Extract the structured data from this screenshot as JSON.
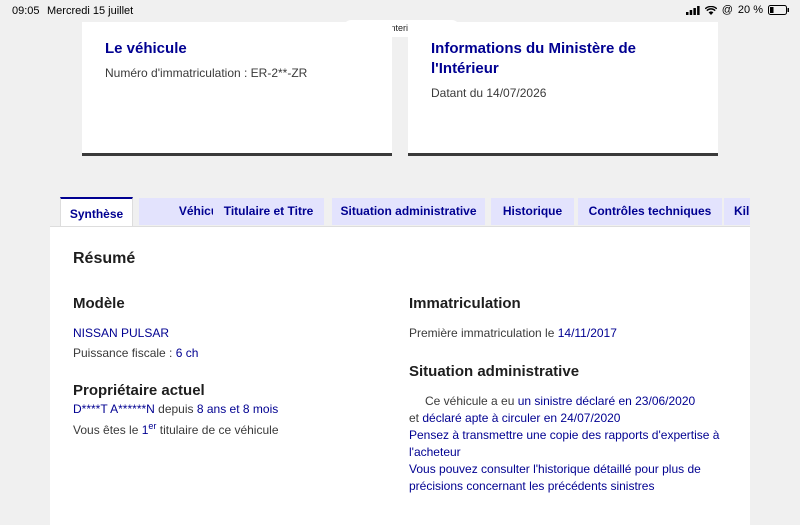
{
  "status": {
    "time": "09:05",
    "date": "Mercredi 15 juillet",
    "battery": "20 %"
  },
  "url": "histovec.interieur.gouv.fr",
  "cards": {
    "vehicle": {
      "title": "Le véhicule",
      "subtitle": "Numéro d'immatriculation : ER-2**-ZR"
    },
    "ministry": {
      "title": "Informations du Ministère de l'Intérieur",
      "subtitle": "Datant du 14/07/2026"
    }
  },
  "tabs": [
    "Synthèse",
    "Véhicule",
    "Titulaire et Titre",
    "Situation administrative",
    "Historique",
    "Contrôles techniques",
    "Kil"
  ],
  "summary": {
    "heading": "Résumé",
    "model": {
      "heading": "Modèle",
      "name": "NISSAN PULSAR",
      "power_label": "Puissance fiscale : ",
      "power_value": "6 ch"
    },
    "owner": {
      "heading": "Propriétaire actuel",
      "name": "D****T A******N",
      "since_label": " depuis ",
      "since_value": "8 ans et 8 mois",
      "rank_prefix": "Vous êtes le ",
      "rank_num": "1",
      "rank_sup": "er",
      "rank_suffix": " titulaire de ce véhicule"
    },
    "registration": {
      "heading": "Immatriculation",
      "label": "Première immatriculation le ",
      "date": "14/11/2017"
    },
    "admin": {
      "heading": "Situation administrative",
      "line1_prefix": "Ce véhicule a eu ",
      "line1_link": "un sinistre déclaré en 23/06/2020",
      "line2_prefix": "et ",
      "line2_link": "déclaré apte à circuler en 24/07/2020",
      "note1a": "Pensez à transmettre une copie des rapports d'expertise à",
      "note1b": "l'acheteur",
      "note2a": "Vous pouvez consulter l'historique détaillé pour plus de",
      "note2b": "précisions concernant les précédents sinistres"
    }
  }
}
